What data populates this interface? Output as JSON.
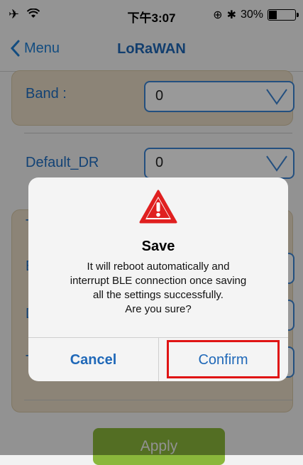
{
  "status_bar": {
    "left_icons": "✈ ᯤ",
    "time": "下午3:07",
    "right_text": "30%",
    "battery_level": 0.3,
    "icons": [
      "airplane-icon",
      "wifi-icon",
      "orientation-lock-icon",
      "bluetooth-icon",
      "battery-icon"
    ]
  },
  "nav": {
    "back_label": "Menu",
    "title": "LoRaWAN"
  },
  "form": {
    "band_label": "Band :",
    "band_value": "0",
    "default_dr_label": "Default_DR",
    "default_dr_value": "0",
    "partial_labels": [
      "T",
      "E",
      "D",
      "T"
    ]
  },
  "apply_label": "Apply",
  "alert": {
    "title": "Save",
    "message_lines": [
      "It will reboot automatically and",
      "interrupt BLE connection once saving",
      "all the settings  successfully.",
      "Are you sure?"
    ],
    "cancel_label": "Cancel",
    "confirm_label": "Confirm"
  },
  "colors": {
    "accent": "#1f68b8",
    "panel": "#e9ddc6",
    "apply": "#8ab73b",
    "highlight": "#e01414",
    "warning": "#e02020"
  }
}
